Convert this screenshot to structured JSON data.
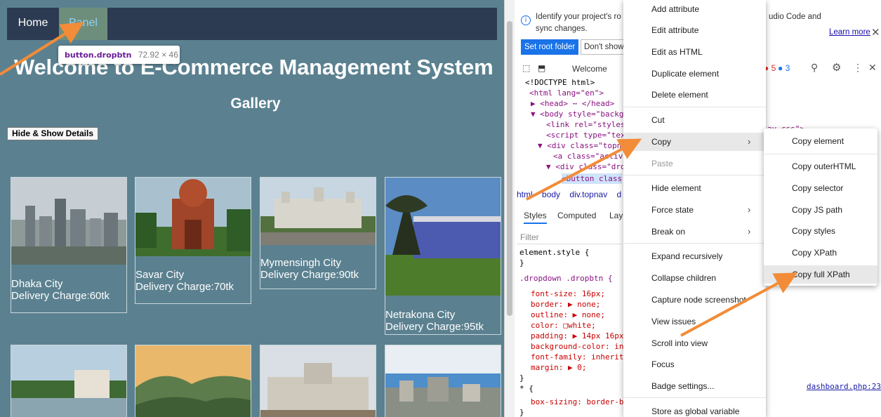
{
  "site": {
    "nav": {
      "home": "Home",
      "panel": "Panel"
    },
    "tooltip": {
      "selector": "button.dropbtn",
      "size": "72.92 × 46"
    },
    "title": "Welcome to E-Commerce Management System",
    "gallery_heading": "Gallery",
    "hide_show_button": "Hide & Show Details",
    "cards": [
      {
        "city": "Dhaka City",
        "charge": "Delivery Charge:60tk"
      },
      {
        "city": "Savar City",
        "charge": "Delivery Charge:70tk"
      },
      {
        "city": "Mymensingh City",
        "charge": "Delivery Charge:90tk"
      },
      {
        "city": "Netrakona City",
        "charge": "Delivery Charge:95tk"
      }
    ]
  },
  "devtools": {
    "info_text_1": "Identify your project's ro",
    "info_text_2": "sync changes.",
    "vscode_text": "udio Code and",
    "set_root": "Set root folder",
    "dont_show": "Don't show",
    "learn_more": "Learn more",
    "welcome_tab": "Welcome",
    "issues_red": "5",
    "issues_blue": "3",
    "dom": [
      "<!DOCTYPE html>",
      "<html lang=\"en\">",
      "▶ <head> ⋯ </head>",
      "▼ <body style=\"backgr",
      "<link rel=\"stylesh",
      "<script type=\"tex",
      "▼ <div class=\"topn",
      "<a class=\"active",
      "▼ <div class=\"drop",
      "<button class"
    ],
    "css_fragment": "av.css\">",
    "crumbs": [
      "html",
      "body",
      "div.topnav",
      "d"
    ],
    "styles_tabs": [
      "Styles",
      "Computed",
      "Lay"
    ],
    "filter_placeholder": "Filter",
    "css": [
      "element.style {",
      "}",
      ".dropdown .dropbtn {",
      "font-size: 16px;",
      "border: ▶ none;",
      "outline: ▶ none;",
      "color: □white;",
      "padding: ▶ 14px 16px;",
      "background-color: inh",
      "font-family: inherit;",
      "margin: ▶ 0;",
      "}",
      "* {",
      "box-sizing: border-bo",
      "}"
    ],
    "source_link": "dashboard.php:23"
  },
  "context_menu": {
    "items": [
      {
        "label": "Add attribute"
      },
      {
        "label": "Edit attribute"
      },
      {
        "label": "Edit as HTML"
      },
      {
        "label": "Duplicate element"
      },
      {
        "label": "Delete element"
      },
      {
        "label": "Cut"
      },
      {
        "label": "Copy"
      },
      {
        "label": "Paste"
      },
      {
        "label": "Hide element"
      },
      {
        "label": "Force state"
      },
      {
        "label": "Break on"
      },
      {
        "label": "Expand recursively"
      },
      {
        "label": "Collapse children"
      },
      {
        "label": "Capture node screenshot"
      },
      {
        "label": "View issues"
      },
      {
        "label": "Scroll into view"
      },
      {
        "label": "Focus"
      },
      {
        "label": "Badge settings..."
      },
      {
        "label": "Store as global variable"
      }
    ]
  },
  "copy_submenu": {
    "items": [
      {
        "label": "Copy element"
      },
      {
        "label": "Copy outerHTML"
      },
      {
        "label": "Copy selector"
      },
      {
        "label": "Copy JS path"
      },
      {
        "label": "Copy styles"
      },
      {
        "label": "Copy XPath"
      },
      {
        "label": "Copy full XPath"
      }
    ]
  },
  "colors": {
    "site_bg": "#5b8190",
    "nav_bg": "#2c3b52",
    "arrow": "#f28c38",
    "link_blue": "#1a73e8"
  }
}
